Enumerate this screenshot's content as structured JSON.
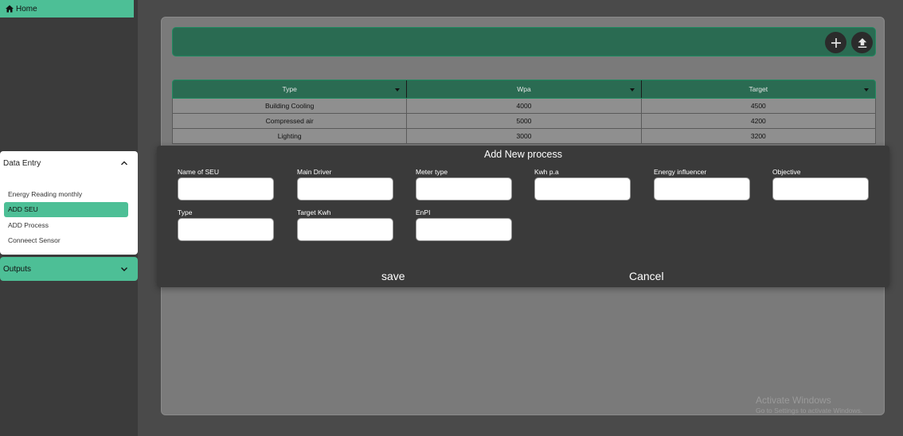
{
  "sidebar": {
    "home_label": "Home",
    "data_entry": {
      "title": "Data Entry",
      "items": [
        {
          "label": "Energy Reading monthly"
        },
        {
          "label": "ADD SEU"
        },
        {
          "label": "ADD Process"
        },
        {
          "label": "Conneect Sensor"
        }
      ]
    },
    "outputs": {
      "title": "Outputs"
    }
  },
  "toolbar": {
    "add_icon": "plus-icon",
    "upload_icon": "upload-icon"
  },
  "table": {
    "columns": [
      "Type",
      "Wpa",
      "Target"
    ],
    "rows": [
      [
        "Building Cooling",
        "4000",
        "4500"
      ],
      [
        "Compressed air",
        "5000",
        "4200"
      ],
      [
        "Lighting",
        "3000",
        "3200"
      ]
    ]
  },
  "dialog": {
    "title": "Add New process",
    "fields": [
      {
        "label": "Name of SEU",
        "value": ""
      },
      {
        "label": "Main Driver",
        "value": ""
      },
      {
        "label": "Meter type",
        "value": ""
      },
      {
        "label": "Kwh p.a",
        "value": ""
      },
      {
        "label": "Energy influencer",
        "value": ""
      },
      {
        "label": "Objective",
        "value": ""
      },
      {
        "label": "Type",
        "value": ""
      },
      {
        "label": "Target Kwh",
        "value": ""
      },
      {
        "label": "EnPI",
        "value": ""
      }
    ],
    "save_label": "save",
    "cancel_label": "Cancel"
  },
  "watermark": {
    "title": "Activate Windows",
    "subtitle": "Go to Settings to activate Windows."
  },
  "colors": {
    "accent": "#4dbf96",
    "header_green": "#2a6b52",
    "sidebar_bg": "#3b3b3b",
    "dialog_bg": "#3a3a3a"
  }
}
